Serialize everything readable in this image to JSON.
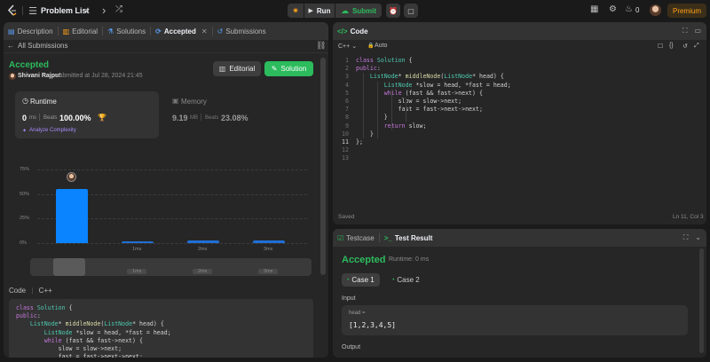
{
  "topbar": {
    "logo": "leetcode-logo",
    "problem_list": "Problem List",
    "run": "Run",
    "submit": "Submit",
    "coins": "0",
    "premium": "Premium"
  },
  "left_tabs": [
    {
      "label": "Description"
    },
    {
      "label": "Editorial"
    },
    {
      "label": "Solutions"
    },
    {
      "label": "Accepted"
    },
    {
      "label": "Submissions"
    }
  ],
  "subheader": {
    "back": "All Submissions"
  },
  "result": {
    "status": "Accepted",
    "user": "Shivani Rajput",
    "submitted": "submitted at Jul 28, 2024 21:45",
    "editorial_btn": "Editorial",
    "solution_btn": "Solution"
  },
  "runtime": {
    "title": "Runtime",
    "value": "0",
    "unit": "ms",
    "beats_label": "Beats",
    "beats": "100.00%",
    "analyze": "Analyze Complexity"
  },
  "memory": {
    "title": "Memory",
    "value": "9.19",
    "unit": "MB",
    "beats_label": "Beats",
    "beats": "23.08%"
  },
  "chart_data": {
    "type": "bar",
    "y_ticks": [
      "75%",
      "50%",
      "25%",
      "0%"
    ],
    "ylim": [
      0,
      75
    ],
    "categories": [
      "0ms",
      "1ms",
      "2ms",
      "3ms"
    ],
    "values": [
      55,
      2,
      3,
      2.5
    ],
    "highlight_index": 0,
    "highlight_color": "#0a84ff",
    "mini_labels": [
      "1ms",
      "2ms",
      "3ms"
    ]
  },
  "code_label": {
    "code": "Code",
    "lang": "C++"
  },
  "left_code": [
    "class Solution {",
    "public:",
    "    ListNode* middleNode(ListNode* head) {",
    "        ListNode *slow = head, *fast = head;",
    "        while (fast && fast->next) {",
    "            slow = slow->next;",
    "            fast = fast->next->next;",
    "        }"
  ],
  "editor": {
    "title": "Code",
    "lang": "C++",
    "mode": "Auto",
    "saved": "Saved",
    "cursor": "Ln 11, Col 3",
    "lines": [
      "class Solution {",
      "public:",
      "    ListNode* middleNode(ListNode* head) {",
      "        ListNode *slow = head, *fast = head;",
      "        while (fast && fast->next) {",
      "            slow = slow->next;",
      "            fast = fast->next->next;",
      "        }",
      "        return slow;",
      "    }",
      "};"
    ],
    "line_numbers": [
      "1",
      "2",
      "3",
      "4",
      "5",
      "6",
      "7",
      "8",
      "9",
      "10",
      "11",
      "12",
      "13"
    ]
  },
  "tests": {
    "tab_testcase": "Testcase",
    "tab_result": "Test Result",
    "status": "Accepted",
    "runtime": "Runtime: 0 ms",
    "cases": [
      "Case 1",
      "Case 2"
    ],
    "input_label": "Input",
    "var": "head =",
    "value": "[1,2,3,4,5]",
    "output_label": "Output"
  },
  "colors": {
    "accepted": "#2cbb5d",
    "accent_blue": "#0a84ff",
    "premium": "#ffa116"
  }
}
